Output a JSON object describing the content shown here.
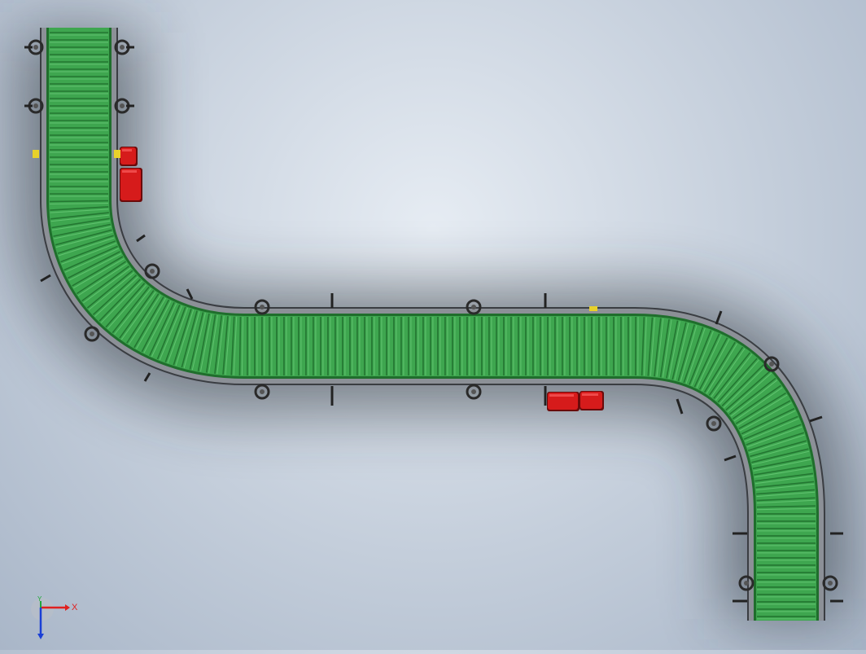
{
  "viewport": {
    "background_color": "#c4cedb",
    "conveyor": {
      "roller_color": "#3ea64f",
      "roller_dark_color": "#1f6e2c",
      "frame_color": "#8c9097",
      "frame_dark_color": "#3a3d42",
      "motor_color": "#d61b1b",
      "motor_dark_color": "#6a0a0a",
      "caster_color": "#2a2a2a",
      "gear_motor_count": 2
    }
  },
  "triad": {
    "x_label": "X",
    "y_label": "Y",
    "x_color": "#e0201f",
    "y_color": "#1fa83a",
    "z_color": "#1a3fd6"
  }
}
